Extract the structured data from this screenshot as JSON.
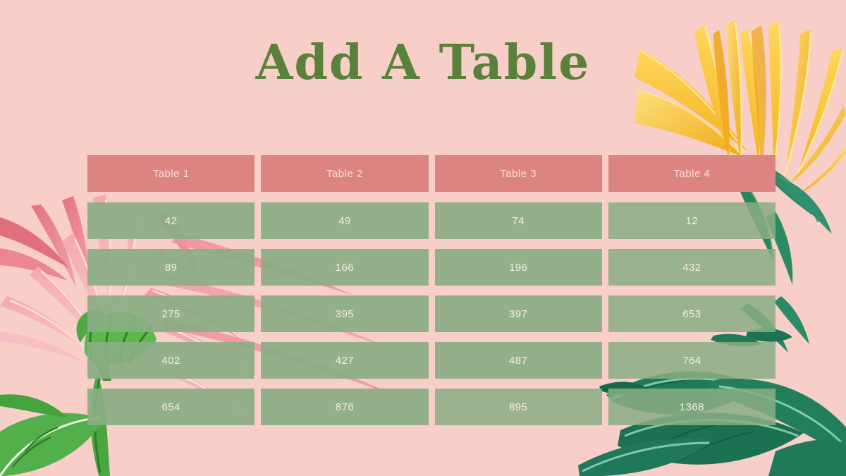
{
  "slide": {
    "title": "Add A Table",
    "background_color": "#F7CFC8",
    "title_color": "#5A8139",
    "header_bg_color": "#DC8481",
    "header_text_color": "#F8DFD9",
    "cell_bg_color": "#8AAE84",
    "cell_text_color": "#F6EDE3"
  },
  "table": {
    "headers": [
      "Table 1",
      "Table 2",
      "Table 3",
      "Table 4"
    ],
    "rows": [
      [
        "42",
        "49",
        "74",
        "12"
      ],
      [
        "89",
        "166",
        "196",
        "432"
      ],
      [
        "275",
        "395",
        "397",
        "653"
      ],
      [
        "402",
        "427",
        "487",
        "764"
      ],
      [
        "654",
        "876",
        "895",
        "1368"
      ]
    ]
  },
  "decorations": {
    "top_right_flower": "yellow-daisy-flower",
    "left_flower": "pink-daisy-flower",
    "bottom_left_leaf": "green-leaf",
    "bottom_right_leaves": "dark-green-leaves",
    "stem": "green-stem"
  },
  "chart_data": {
    "type": "table",
    "title": "Add A Table",
    "categories": [
      "Table 1",
      "Table 2",
      "Table 3",
      "Table 4"
    ],
    "series": [
      {
        "name": "Table 1",
        "values": [
          42,
          89,
          275,
          402,
          654
        ]
      },
      {
        "name": "Table 2",
        "values": [
          49,
          166,
          395,
          427,
          876
        ]
      },
      {
        "name": "Table 3",
        "values": [
          74,
          196,
          397,
          487,
          895
        ]
      },
      {
        "name": "Table 4",
        "values": [
          12,
          432,
          653,
          764,
          1368
        ]
      }
    ],
    "xlabel": "",
    "ylabel": "",
    "grid": false,
    "legend": "none"
  }
}
